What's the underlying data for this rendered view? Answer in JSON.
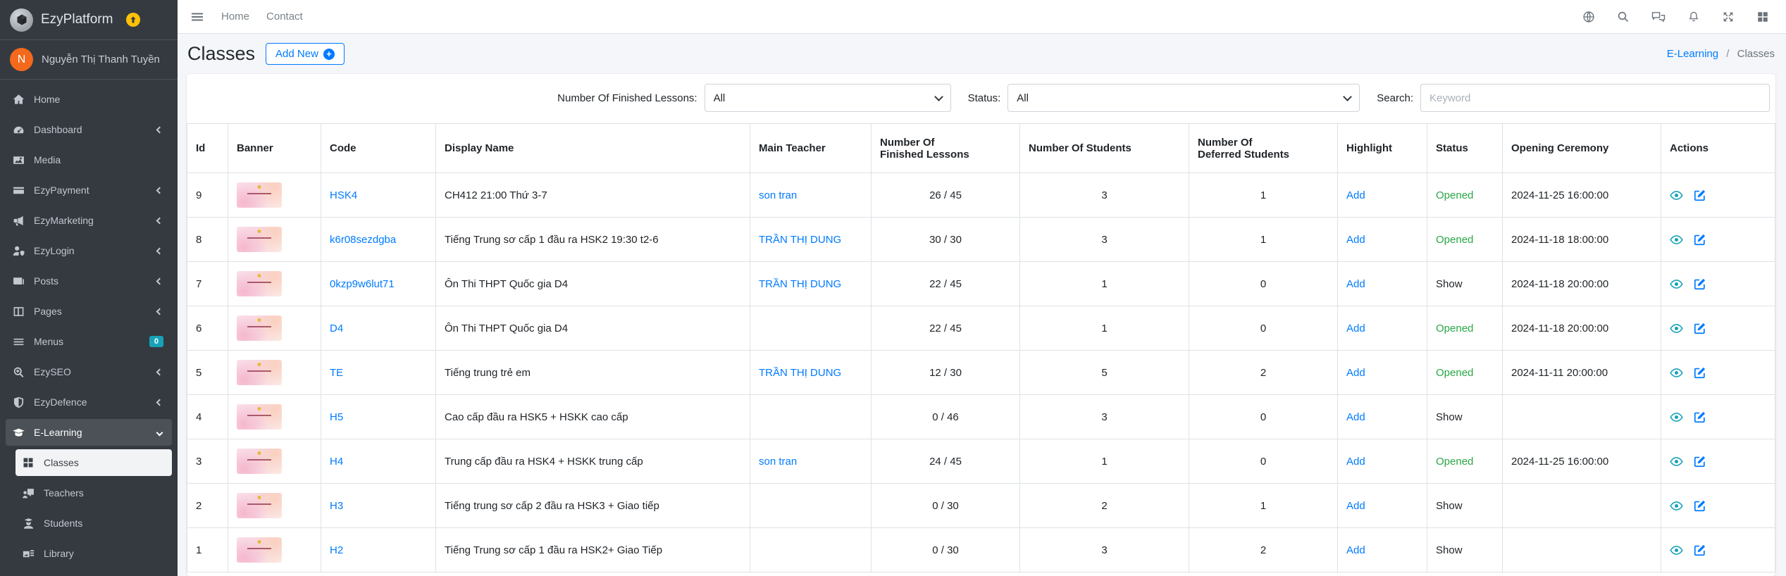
{
  "colors": {
    "accent_blue": "#007bff",
    "status_opened_green": "#28a745",
    "view_icon_teal": "#17a2b8",
    "menus_badge_teal": "#17a2b8",
    "avatar_orange": "#f4691c",
    "upgrade_badge_amber": "#ffc107",
    "sidebar_bg": "#343a40",
    "content_bg": "#f4f6f9",
    "table_border": "#dee2e6",
    "text_dark": "#212529",
    "text_muted": "#6c757d",
    "sidebar_text": "#c2c7d0",
    "banner_pink": "#f7d9e4"
  },
  "sidebar": {
    "brand": "EzyPlatform",
    "brand_logo_icon": "cube-icon",
    "brand_upgrade_icon": "arrow-up-circle-icon",
    "user": {
      "initial": "N",
      "name": "Nguyễn Thị Thanh Tuyền"
    },
    "items": [
      {
        "label": "Home",
        "icon": "home"
      },
      {
        "label": "Dashboard",
        "icon": "gauge",
        "expandable": true
      },
      {
        "label": "Media",
        "icon": "image"
      },
      {
        "label": "EzyPayment",
        "icon": "credit-card",
        "expandable": true
      },
      {
        "label": "EzyMarketing",
        "icon": "megaphone",
        "expandable": true
      },
      {
        "label": "EzyLogin",
        "icon": "user-shield",
        "expandable": true
      },
      {
        "label": "Posts",
        "icon": "newspaper",
        "expandable": true
      },
      {
        "label": "Pages",
        "icon": "columns",
        "expandable": true
      },
      {
        "label": "Menus",
        "icon": "bars",
        "badge": "0"
      },
      {
        "label": "EzySEO",
        "icon": "search-seo",
        "expandable": true
      },
      {
        "label": "EzyDefence",
        "icon": "shield",
        "expandable": true
      },
      {
        "label": "E-Learning",
        "icon": "graduation-cap",
        "expandable": true,
        "expanded": true,
        "active": true,
        "children": [
          {
            "label": "Classes",
            "icon": "grid",
            "active": true
          },
          {
            "label": "Teachers",
            "icon": "chalkboard-teacher"
          },
          {
            "label": "Students",
            "icon": "user-graduate"
          },
          {
            "label": "Library",
            "icon": "photo-film"
          }
        ]
      }
    ]
  },
  "topnav": {
    "links": [
      {
        "label": "Home"
      },
      {
        "label": "Contact"
      }
    ],
    "icons": [
      "globe",
      "search",
      "comments",
      "bell",
      "fullscreen",
      "grid-large"
    ]
  },
  "page": {
    "title": "Classes",
    "add_new_label": "Add New",
    "breadcrumb": {
      "parent": "E-Learning",
      "current": "Classes"
    }
  },
  "filters": {
    "finished_lessons": {
      "label": "Number Of Finished Lessons:",
      "value": "All"
    },
    "status": {
      "label": "Status:",
      "value": "All"
    },
    "search": {
      "label": "Search:",
      "placeholder": "Keyword"
    }
  },
  "table": {
    "columns": [
      "Id",
      "Banner",
      "Code",
      "Display Name",
      "Main Teacher",
      "Number Of\nFinished Lessons",
      "Number Of Students",
      "Number Of\nDeferred Students",
      "Highlight",
      "Status",
      "Opening Ceremony",
      "Actions"
    ],
    "rows": [
      {
        "id": "9",
        "code": "HSK4",
        "display_name": "CH412 21:00 Thứ 3-7",
        "main_teacher": "son tran",
        "finished_lessons": "26 / 45",
        "students": "3",
        "deferred": "1",
        "highlight": "Add",
        "status": "Opened",
        "opening_ceremony": "2024-11-25 16:00:00"
      },
      {
        "id": "8",
        "code": "k6r08sezdgba",
        "display_name": "Tiếng Trung sơ cấp 1 đầu ra HSK2 19:30 t2-6",
        "main_teacher": "TRẦN THỊ DUNG",
        "finished_lessons": "30 / 30",
        "students": "3",
        "deferred": "1",
        "highlight": "Add",
        "status": "Opened",
        "opening_ceremony": "2024-11-18 18:00:00"
      },
      {
        "id": "7",
        "code": "0kzp9w6lut71",
        "display_name": "Ôn Thi THPT Quốc gia D4",
        "main_teacher": "TRẦN THỊ DUNG",
        "finished_lessons": "22 / 45",
        "students": "1",
        "deferred": "0",
        "highlight": "Add",
        "status": "Show",
        "opening_ceremony": "2024-11-18 20:00:00"
      },
      {
        "id": "6",
        "code": "D4",
        "display_name": "Ôn Thi THPT Quốc gia D4",
        "main_teacher": "",
        "finished_lessons": "22 / 45",
        "students": "1",
        "deferred": "0",
        "highlight": "Add",
        "status": "Opened",
        "opening_ceremony": "2024-11-18 20:00:00"
      },
      {
        "id": "5",
        "code": "TE",
        "display_name": "Tiếng trung trẻ em",
        "main_teacher": "TRẦN THỊ DUNG",
        "finished_lessons": "12 / 30",
        "students": "5",
        "deferred": "2",
        "highlight": "Add",
        "status": "Opened",
        "opening_ceremony": "2024-11-11 20:00:00"
      },
      {
        "id": "4",
        "code": "H5",
        "display_name": "Cao cấp đầu ra HSK5 + HSKK cao cấp",
        "main_teacher": "",
        "finished_lessons": "0 / 46",
        "students": "3",
        "deferred": "0",
        "highlight": "Add",
        "status": "Show",
        "opening_ceremony": ""
      },
      {
        "id": "3",
        "code": "H4",
        "display_name": "Trung cấp đầu ra HSK4 + HSKK trung cấp",
        "main_teacher": "son tran",
        "finished_lessons": "24 / 45",
        "students": "1",
        "deferred": "0",
        "highlight": "Add",
        "status": "Opened",
        "opening_ceremony": "2024-11-25 16:00:00"
      },
      {
        "id": "2",
        "code": "H3",
        "display_name": "Tiếng trung sơ cấp 2 đầu ra HSK3 + Giao tiếp",
        "main_teacher": "",
        "finished_lessons": "0 / 30",
        "students": "2",
        "deferred": "1",
        "highlight": "Add",
        "status": "Show",
        "opening_ceremony": ""
      },
      {
        "id": "1",
        "code": "H2",
        "display_name": "Tiếng Trung sơ cấp 1 đầu ra HSK2+ Giao Tiếp",
        "main_teacher": "",
        "finished_lessons": "0 / 30",
        "students": "3",
        "deferred": "2",
        "highlight": "Add",
        "status": "Show",
        "opening_ceremony": ""
      }
    ]
  }
}
